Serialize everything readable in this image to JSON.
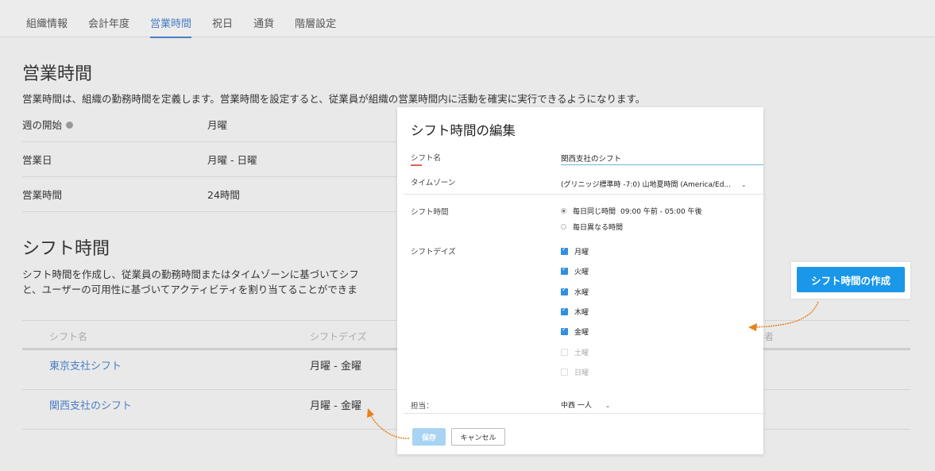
{
  "tabs": [
    {
      "label": "組織情報"
    },
    {
      "label": "会計年度"
    },
    {
      "label": "営業時間"
    },
    {
      "label": "祝日"
    },
    {
      "label": "通貨"
    },
    {
      "label": "階層設定"
    }
  ],
  "active_tab": "営業時間",
  "business_hours": {
    "title": "営業時間",
    "description": "営業時間は、組織の勤務時間を定義します。営業時間を設定すると、従業員が組織の営業時間内に活動を確実に実行できるようになります。",
    "rows": [
      {
        "label": "週の開始",
        "value": "月曜"
      },
      {
        "label": "営業日",
        "value": "月曜 - 日曜"
      },
      {
        "label": "営業時間",
        "value": "24時間"
      }
    ]
  },
  "shifts": {
    "title": "シフト時間",
    "description_line1": "シフト時間を作成し、従業員の勤務時間またはタイムゾーンに基づいてシフ",
    "description_line2": "と、ユーザーの可用性に基づいてアクティビティを割り当てることができま",
    "columns": {
      "name": "シフト名",
      "days": "シフトデイズ",
      "owner_partial": "者"
    },
    "rows": [
      {
        "name": "東京支社シフト",
        "days": "月曜 - 金曜"
      },
      {
        "name": "関西支社のシフト",
        "days": "月曜 - 金曜"
      }
    ],
    "create_button": "シフト時間の作成"
  },
  "modal": {
    "title": "シフト時間の編集",
    "shift_name_label": "シフト名",
    "shift_name_value": "関西支社のシフト",
    "timezone_label": "タイムゾーン",
    "timezone_value": "(グリニッジ標準時 -7:0) 山地夏時間 (America/Ed...",
    "shift_time_label": "シフト時間",
    "option_same": "毎日同じ時間",
    "time_range": "09:00 午前 -  05:00 午後",
    "option_different": "毎日異なる時間",
    "shift_days_label": "シフトデイズ",
    "days": [
      {
        "label": "月曜",
        "checked": true
      },
      {
        "label": "火曜",
        "checked": true
      },
      {
        "label": "水曜",
        "checked": true
      },
      {
        "label": "木曜",
        "checked": true
      },
      {
        "label": "金曜",
        "checked": true
      },
      {
        "label": "土曜",
        "checked": false
      },
      {
        "label": "日曜",
        "checked": false
      }
    ],
    "assignee_label": "担当：",
    "assignee_value": "中西 一人",
    "save_label": "保存",
    "cancel_label": "キャンセル"
  },
  "colors": {
    "accent": "#4a7ec4",
    "primary_button": "#1a97e8",
    "arrow": "#e8821e"
  }
}
